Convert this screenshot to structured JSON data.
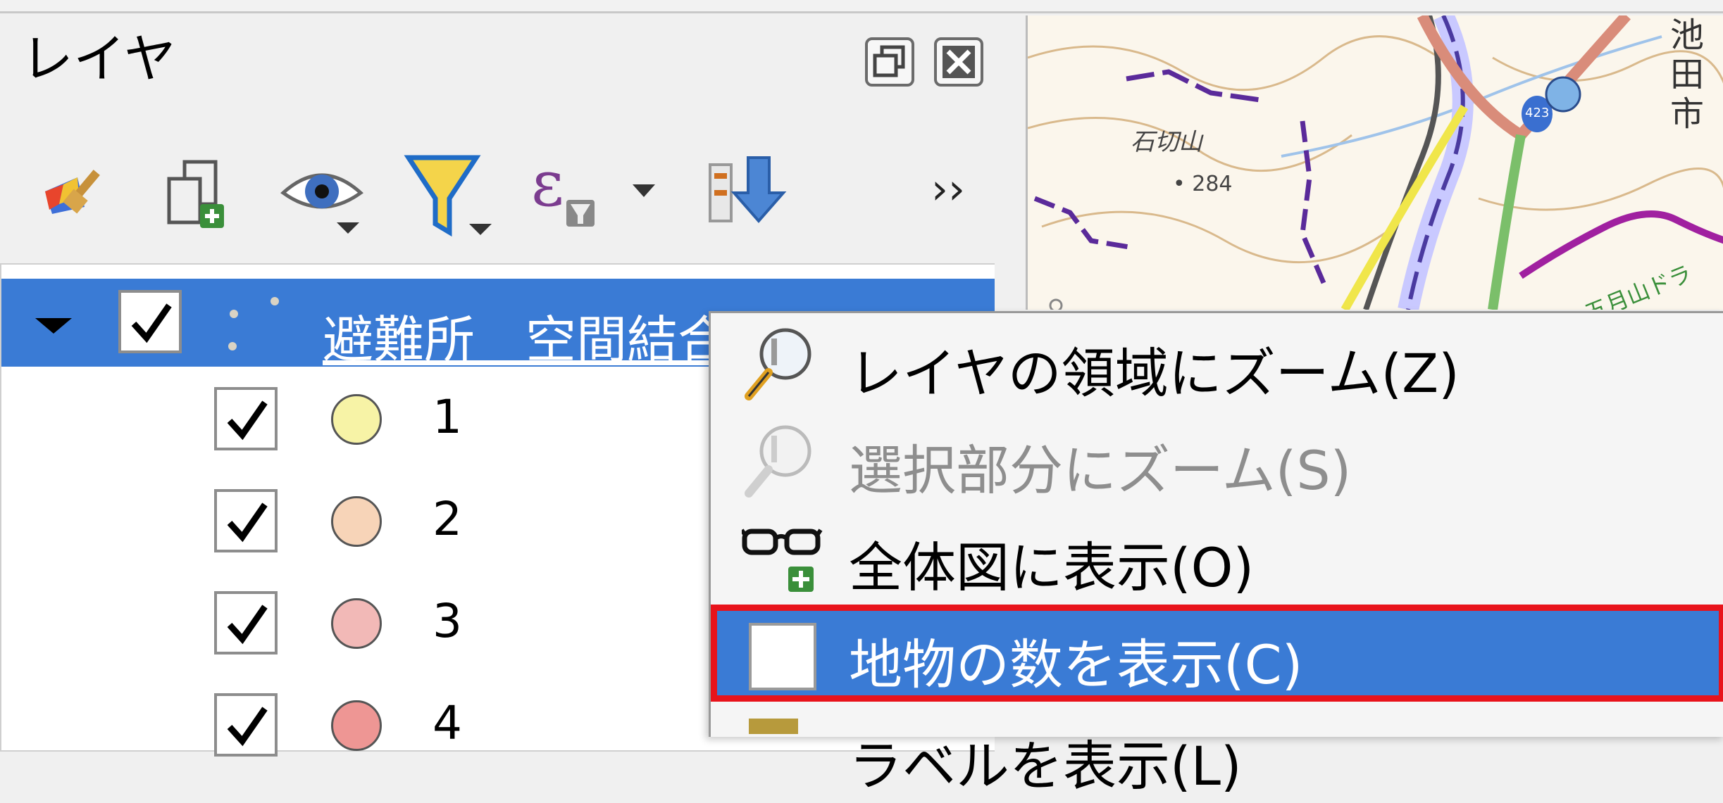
{
  "panel": {
    "title": "レイヤ",
    "float_icon": "restore-window-icon",
    "close_icon": "close-icon",
    "toolbar": {
      "icons": [
        "style-brush-icon",
        "add-group-icon",
        "visibility-eye-icon",
        "filter-funnel-icon",
        "expression-filter-icon",
        "move-layer-down-icon"
      ],
      "more_label": "››"
    }
  },
  "tree": {
    "layer": {
      "name": "避難所＿空間結合",
      "checked": true
    },
    "classes": [
      {
        "label": "1",
        "color": "#f7f3a6",
        "checked": true
      },
      {
        "label": "2",
        "color": "#f7d4b8",
        "checked": true
      },
      {
        "label": "3",
        "color": "#f2b9b7",
        "checked": true
      },
      {
        "label": "4",
        "color": "#ee9694",
        "checked": true
      }
    ]
  },
  "map": {
    "labels": {
      "mountain": "石切山",
      "elevation": "• 284",
      "city": "池田市",
      "route": "423",
      "course": "五月山ドラ"
    }
  },
  "context_menu": {
    "items": [
      {
        "label": "レイヤの領域にズーム(Z)",
        "icon": "zoom-layer-icon",
        "enabled": true
      },
      {
        "label": "選択部分にズーム(S)",
        "icon": "zoom-selection-icon",
        "enabled": false
      },
      {
        "label": "全体図に表示(O)",
        "icon": "overview-glasses-icon",
        "enabled": true
      },
      {
        "label": "地物の数を表示(C)",
        "icon": "checkbox-icon",
        "enabled": true,
        "highlighted": true
      },
      {
        "label": "ラベルを表示(L)",
        "icon": "label-icon",
        "enabled": true
      }
    ]
  },
  "colors": {
    "selection": "#3a7bd5",
    "highlight_border": "#e8131b"
  }
}
